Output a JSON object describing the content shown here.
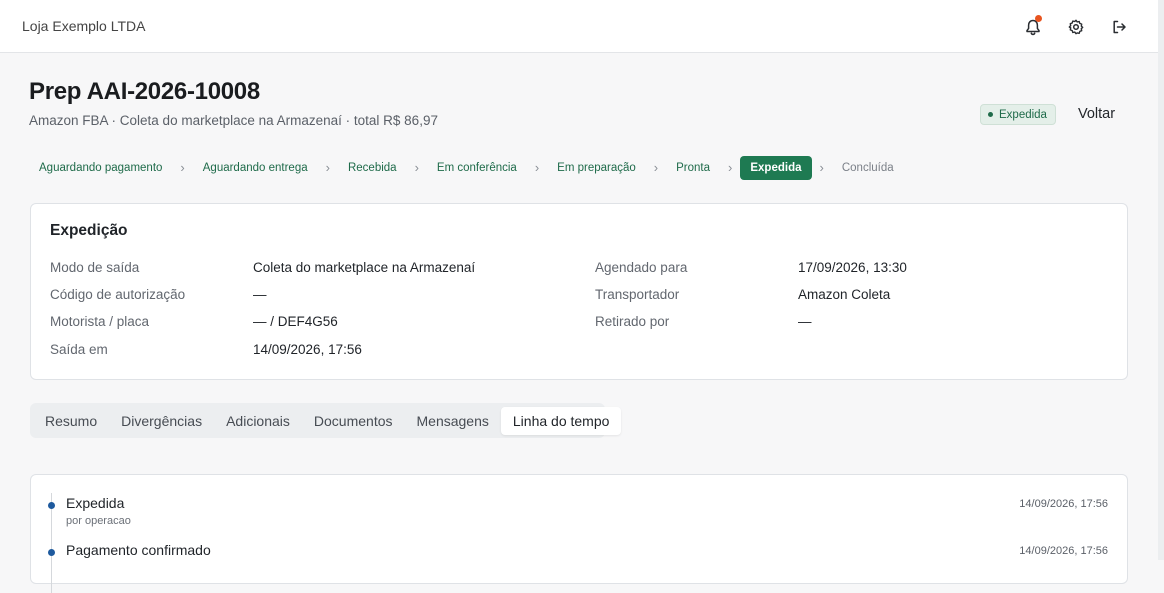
{
  "header": {
    "brand": "Loja Exemplo LTDA",
    "icons": [
      "bell-icon",
      "gear-icon",
      "logout-icon"
    ]
  },
  "page": {
    "title": "Prep AAI-2026-10008",
    "subtitle": "Amazon FBA · Coleta do marketplace na Armazenaí · total R$ 86,97",
    "status_badge": "Expedida",
    "back_label": "Voltar"
  },
  "stepper": {
    "steps": [
      {
        "label": "Aguardando pagamento",
        "state": "done"
      },
      {
        "label": "Aguardando entrega",
        "state": "done"
      },
      {
        "label": "Recebida",
        "state": "done"
      },
      {
        "label": "Em conferência",
        "state": "done"
      },
      {
        "label": "Em preparação",
        "state": "done"
      },
      {
        "label": "Pronta",
        "state": "done"
      },
      {
        "label": "Expedida",
        "state": "active"
      },
      {
        "label": "Concluída",
        "state": "todo"
      }
    ]
  },
  "shipping": {
    "title": "Expedição",
    "left": [
      {
        "label": "Modo de saída",
        "value": "Coleta do marketplace na Armazenaí"
      },
      {
        "label": "Código de autorização",
        "value": "—"
      },
      {
        "label": "Motorista / placa",
        "value": "— / DEF4G56"
      },
      {
        "label": "Saída em",
        "value": "14/09/2026, 17:56"
      }
    ],
    "right": [
      {
        "label": "Agendado para",
        "value": "17/09/2026, 13:30"
      },
      {
        "label": "Transportador",
        "value": "Amazon Coleta"
      },
      {
        "label": "Retirado por",
        "value": "—"
      }
    ]
  },
  "tabs": {
    "items": [
      "Resumo",
      "Divergências",
      "Adicionais",
      "Documentos",
      "Mensagens",
      "Linha do tempo"
    ],
    "active": "Linha do tempo"
  },
  "timeline": {
    "events": [
      {
        "title": "Expedida",
        "by": "por operacao",
        "time": "14/09/2026, 17:56"
      },
      {
        "title": "Pagamento confirmado",
        "by": "",
        "time": "14/09/2026, 17:56"
      }
    ]
  },
  "colors": {
    "accent_green": "#1e7a52",
    "notification_dot": "#e8541f",
    "timeline_dot": "#1e5a9e"
  }
}
